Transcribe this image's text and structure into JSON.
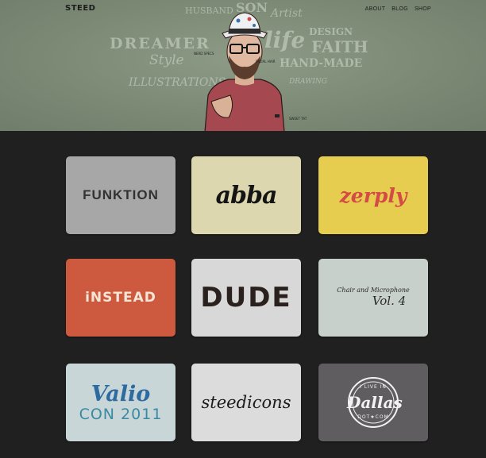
{
  "site": {
    "logo": "STEED"
  },
  "nav": {
    "items": [
      "ABOUT",
      "BLOG",
      "SHOP"
    ]
  },
  "hero": {
    "words": [
      "HUSBAND",
      "SON",
      "Artist",
      "DREAMER",
      "life",
      "DESIGN",
      "FAITH",
      "Style",
      "HAND-MADE",
      "ILLUSTRATIONS",
      "DRAWING"
    ],
    "notes": [
      "NERD SPECS",
      "FACIAL HAIR",
      "SWEET TAT"
    ]
  },
  "portfolio": {
    "funktion": "FUNKTION",
    "abba": "abba",
    "zerply": "zerply",
    "instead": "iNSTEAD",
    "dude": "DUDE",
    "chair_line": "Chair and Microphone",
    "chair_vol": "Vol. 4",
    "valio": "Valio",
    "valio_con": "CON 2011",
    "steedicons": "steedicons",
    "dallas_top": "I LIVE IN",
    "dallas_main": "Dallas",
    "dallas_bottom": "DOT★COM"
  },
  "colors": {
    "hero_bg": "#7e8c78",
    "page_bg": "#202020",
    "zerply_red": "#d44a44",
    "instead_orange": "#cd5a3e",
    "valio_blue": "#2d6aa0"
  }
}
